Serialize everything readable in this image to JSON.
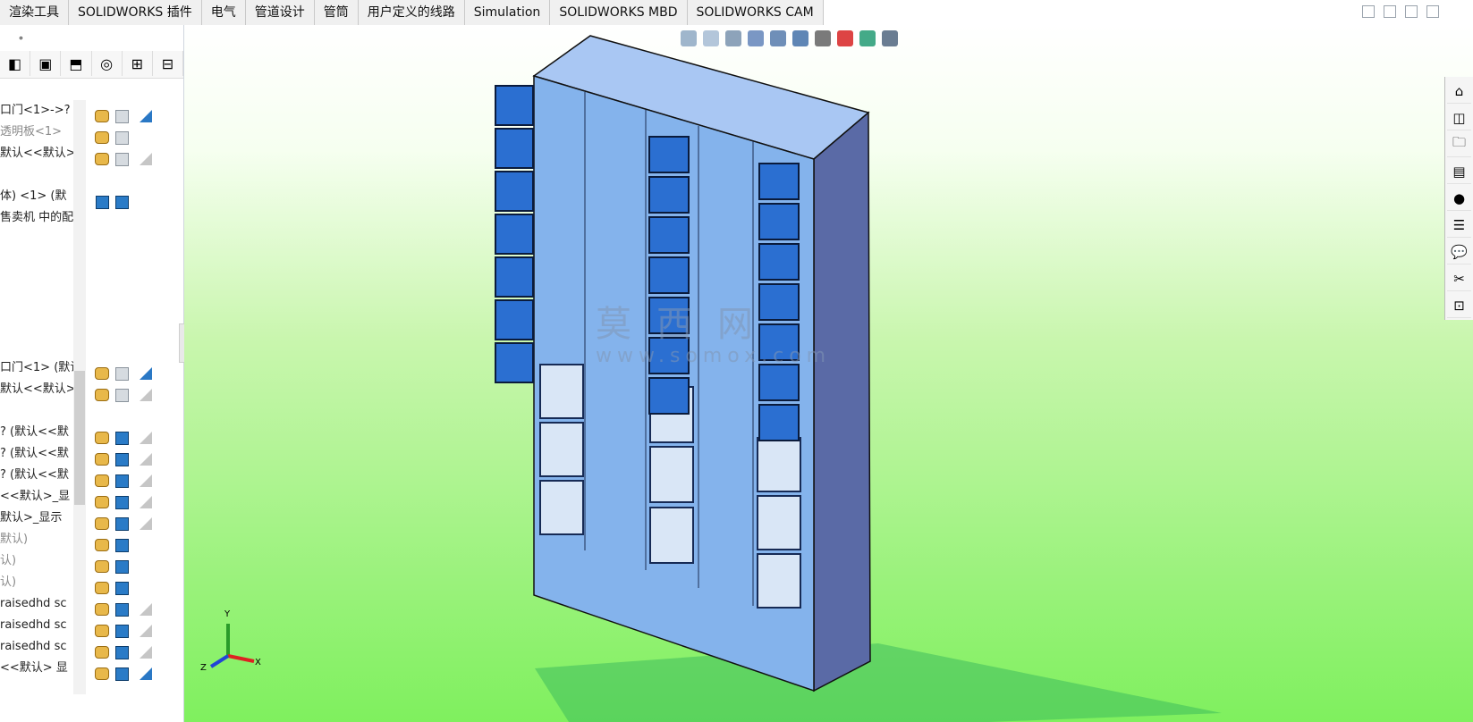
{
  "ribbon_tabs": [
    "渲染工具",
    "SOLIDWORKS 插件",
    "电气",
    "管道设计",
    "管筒",
    "用户定义的线路",
    "Simulation",
    "SOLIDWORKS MBD",
    "SOLIDWORKS CAM"
  ],
  "left_top_text": "∘",
  "icon_row": [
    "◧",
    "▣",
    "⬒",
    "◎",
    "⊞",
    "⊟"
  ],
  "tree_rows": [
    {
      "t": "口门<1>->?",
      "g": false
    },
    {
      "t": "透明板<1>",
      "g": true
    },
    {
      "t": "默认<<默认>",
      "g": false
    },
    {
      "t": "",
      "g": false
    },
    {
      "t": "体) <1> (默",
      "g": false
    },
    {
      "t": "售卖机 中的配",
      "g": false
    },
    {
      "t": "",
      "g": false
    },
    {
      "t": "",
      "g": false
    },
    {
      "t": "",
      "g": false
    },
    {
      "t": "",
      "g": false
    },
    {
      "t": "",
      "g": false
    },
    {
      "t": "",
      "g": false
    },
    {
      "t": "口门<1> (默认",
      "g": false
    },
    {
      "t": "默认<<默认>",
      "g": false
    },
    {
      "t": "",
      "g": false
    },
    {
      "t": "? (默认<<默",
      "g": false
    },
    {
      "t": "? (默认<<默",
      "g": false
    },
    {
      "t": "? (默认<<默",
      "g": false
    },
    {
      "t": "<<默认>_显",
      "g": false
    },
    {
      "t": "默认>_显示",
      "g": false
    },
    {
      "t": "默认)",
      "g": true
    },
    {
      "t": "认)",
      "g": true
    },
    {
      "t": "认)",
      "g": true
    },
    {
      "t": "raisedhd sc",
      "g": false
    },
    {
      "t": "raisedhd sc",
      "g": false
    },
    {
      "t": "raisedhd sc",
      "g": false
    },
    {
      "t": "<<默认> 显",
      "g": false
    }
  ],
  "watermark": "莫西网",
  "watermark_url": "www.somox.com",
  "triad": {
    "x": "X",
    "y": "Y",
    "z": "Z"
  },
  "task_pane_icons": [
    "⌂",
    "◫",
    "🗀",
    "▤",
    "●",
    "☰",
    "💬",
    "✂",
    "⊡"
  ]
}
